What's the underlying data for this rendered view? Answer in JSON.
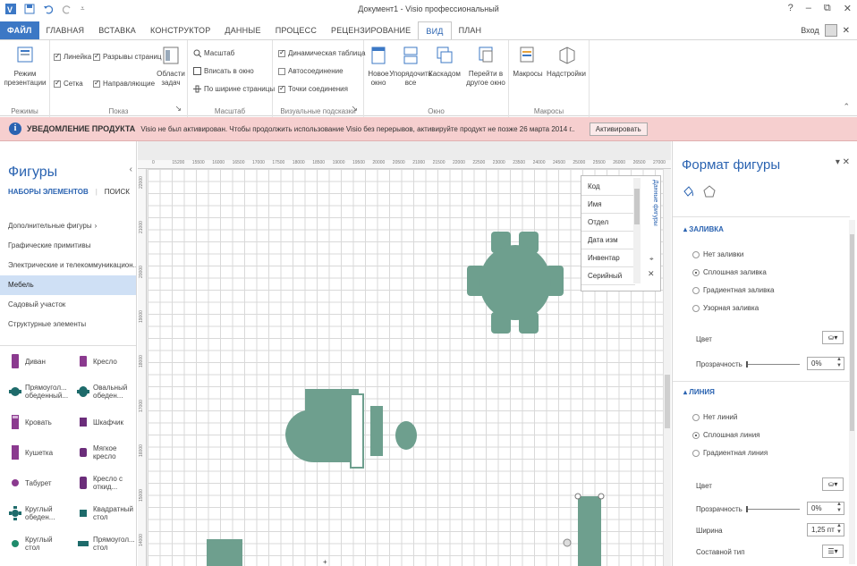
{
  "window": {
    "title": "Документ1 - Visio профессиональный",
    "help": "?",
    "minimize": "–",
    "restore": "⧉",
    "close": "✕"
  },
  "qat": {
    "save": "save-icon",
    "undo": "undo-icon",
    "redo": "redo-icon"
  },
  "tabs": [
    {
      "label": "ФАЙЛ"
    },
    {
      "label": "ГЛАВНАЯ"
    },
    {
      "label": "ВСТАВКА"
    },
    {
      "label": "КОНСТРУКТОР"
    },
    {
      "label": "ДАННЫЕ"
    },
    {
      "label": "ПРОЦЕСС"
    },
    {
      "label": "РЕЦЕНЗИРОВАНИЕ"
    },
    {
      "label": "ВИД"
    },
    {
      "label": "ПЛАН"
    }
  ],
  "active_tab": "ВИД",
  "signin": {
    "label": "Вход"
  },
  "ribbon": {
    "modes": {
      "button": "Режим презентации",
      "group": "Режимы"
    },
    "show": {
      "ruler": "Линейка",
      "page_breaks": "Разрывы страниц",
      "grid": "Сетка",
      "guides": "Направляющие",
      "task_panes": "Области задач",
      "group": "Показ"
    },
    "zoom": {
      "zoom": "Масштаб",
      "fit": "Вписать в окно",
      "page_width": "По ширине страницы",
      "group": "Масштаб"
    },
    "visual_aids": {
      "dynamic_grid": "Динамическая таблица",
      "autoconnect": "Автосоединение",
      "connection_points": "Точки соединения",
      "group": "Визуальные подсказки"
    },
    "window": {
      "new": "Новое окно",
      "arrange": "Упорядочить все",
      "cascade": "Каскадом",
      "switch": "Перейти в другое окно",
      "group": "Окно"
    },
    "macros": {
      "macros": "Макросы",
      "addins": "Надстройки",
      "group": "Макросы"
    }
  },
  "notice": {
    "title": "УВЕДОМЛЕНИЕ ПРОДУКТА",
    "message": "Visio не был активирован. Чтобы продолжить использование Visio без перерывов, активируйте продукт не позже 26 марта 2014 г..",
    "button": "Активировать"
  },
  "shapes_pane": {
    "title": "Фигуры",
    "tab_stencils": "НАБОРЫ ЭЛЕМЕНТОВ",
    "tab_search": "ПОИСК",
    "stencils": [
      {
        "label": "Дополнительные фигуры",
        "arrow": "›"
      },
      {
        "label": "Графические примитивы"
      },
      {
        "label": "Электрические и телекоммуникацион..."
      },
      {
        "label": "Мебель",
        "selected": true
      },
      {
        "label": "Садовый участок"
      },
      {
        "label": "Структурные элементы"
      }
    ],
    "shapes": [
      [
        "Диван",
        "Кресло"
      ],
      [
        "Прямоугол... обеденный...",
        "Овальный обеден..."
      ],
      [
        "Кровать",
        "Шкафчик"
      ],
      [
        "Кушетка",
        "Мягкое кресло"
      ],
      [
        "Табурет",
        "Кресло с откид..."
      ],
      [
        "Круглый обеден...",
        "Квадратный стол"
      ],
      [
        "Круглый стол",
        "Прямоугол... стол"
      ]
    ],
    "shape_color": "#8b3a8f",
    "shape_color2": "#6b2d7a"
  },
  "ruler": {
    "top": [
      "0",
      "15200",
      "15500",
      "16000",
      "16500",
      "17000",
      "17500",
      "18000",
      "18500",
      "19000",
      "19500",
      "20000",
      "20500",
      "21000",
      "21500",
      "22000",
      "22500",
      "23000",
      "23500",
      "24000",
      "24500",
      "25000",
      "25500",
      "26000",
      "26500",
      "27000"
    ],
    "left": [
      "22000",
      "21000",
      "20000",
      "19000",
      "18000",
      "17000",
      "16000",
      "15000",
      "14000"
    ]
  },
  "canvas": {
    "furniture_color": "#6e9f8e"
  },
  "shape_data": {
    "title": "Данные фигуры",
    "rows": [
      "Код",
      "Имя",
      "Отдел",
      "Дата изм",
      "Инвентар",
      "Серийный"
    ]
  },
  "format_pane": {
    "title": "Формат фигуры",
    "fill": {
      "section": "ЗАЛИВКА",
      "options": [
        "Нет заливки",
        "Сплошная заливка",
        "Градиентная заливка",
        "Узорная заливка"
      ],
      "selected": 1,
      "color_label": "Цвет",
      "transparency_label": "Прозрачность",
      "transparency_value": "0%"
    },
    "line": {
      "section": "ЛИНИЯ",
      "options": [
        "Нет линий",
        "Сплошная линия",
        "Градиентная линия"
      ],
      "selected": 1,
      "color_label": "Цвет",
      "transparency_label": "Прозрачность",
      "transparency_value": "0%",
      "width_label": "Ширина",
      "width_value": "1,25 пт",
      "compound_label": "Составной тип"
    }
  },
  "accent": "#2a63b1"
}
